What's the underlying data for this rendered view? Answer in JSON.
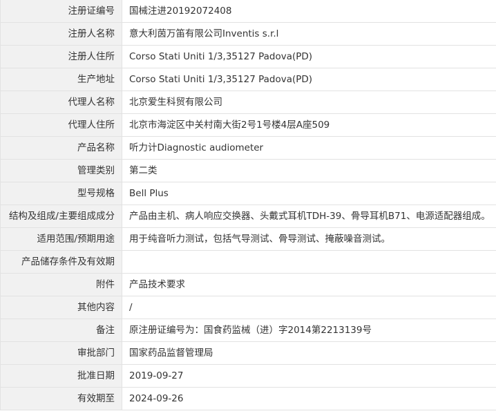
{
  "rows": [
    {
      "label": "注册证编号",
      "value": "国械注进20192072408"
    },
    {
      "label": "注册人名称",
      "value": "意大利茵万笛有限公司Inventis s.r.l"
    },
    {
      "label": "注册人住所",
      "value": "Corso Stati Uniti 1/3,35127 Padova(PD)"
    },
    {
      "label": "生产地址",
      "value": "Corso Stati Uniti 1/3,35127 Padova(PD)"
    },
    {
      "label": "代理人名称",
      "value": "北京爱生科贸有限公司"
    },
    {
      "label": "代理人住所",
      "value": "北京市海淀区中关村南大街2号1号楼4层A座509"
    },
    {
      "label": "产品名称",
      "value": "听力计Diagnostic audiometer"
    },
    {
      "label": "管理类别",
      "value": "第二类"
    },
    {
      "label": "型号规格",
      "value": "Bell Plus"
    },
    {
      "label": "结构及组成/主要组成成分",
      "value": "产品由主机、病人响应交换器、头戴式耳机TDH-39、骨导耳机B71、电源适配器组成。"
    },
    {
      "label": "适用范围/预期用途",
      "value": "用于纯音听力测试，包括气导测试、骨导测试、掩蔽噪音测试。"
    },
    {
      "label": "产品储存条件及有效期",
      "value": ""
    },
    {
      "label": "附件",
      "value": "产品技术要求"
    },
    {
      "label": "其他内容",
      "value": "/"
    },
    {
      "label": "备注",
      "value": "原注册证编号为：国食药监械（进）字2014第2213139号"
    },
    {
      "label": "审批部门",
      "value": "国家药品监督管理局"
    },
    {
      "label": "批准日期",
      "value": "2019-09-27"
    },
    {
      "label": "有效期至",
      "value": "2024-09-26"
    }
  ]
}
